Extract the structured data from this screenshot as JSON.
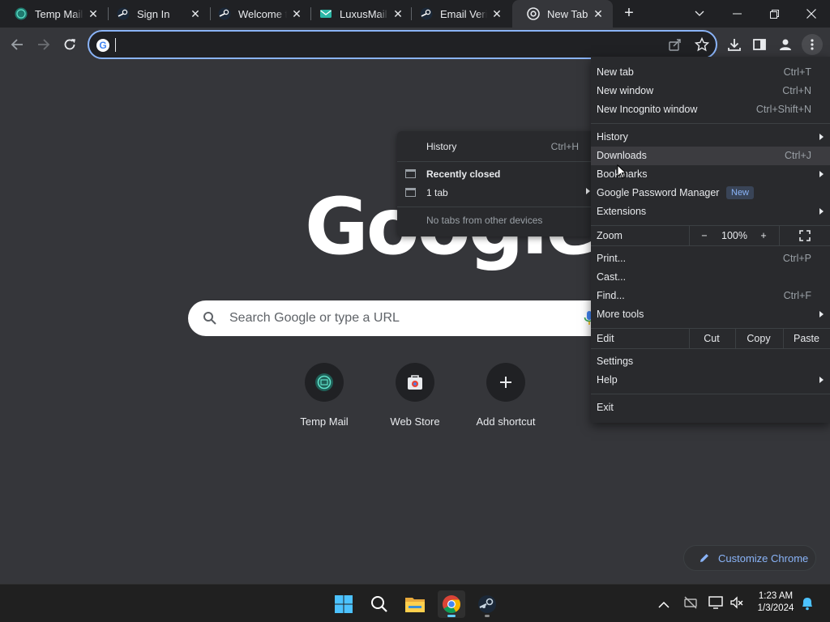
{
  "tabs": [
    {
      "title": "Temp Mail",
      "icon": "temp-mail-favicon"
    },
    {
      "title": "Sign In",
      "icon": "steam-favicon"
    },
    {
      "title": "Welcome to",
      "icon": "steam-favicon"
    },
    {
      "title": "LuxusMail - ",
      "icon": "luxusmail-favicon"
    },
    {
      "title": "Email Verification",
      "icon": "steam-favicon"
    },
    {
      "title": "New Tab",
      "icon": "chrome-favicon"
    }
  ],
  "omnibox": {
    "value": "",
    "placeholder": ""
  },
  "ntp": {
    "logo": "Google",
    "search_placeholder": "Search Google or type a URL",
    "shortcuts": [
      {
        "label": "Temp Mail"
      },
      {
        "label": "Web Store"
      },
      {
        "label": "Add shortcut"
      }
    ],
    "customize_label": "Customize Chrome"
  },
  "history_submenu": {
    "history_label": "History",
    "history_shortcut": "Ctrl+H",
    "recently_closed_label": "Recently closed",
    "one_tab_label": "1 tab",
    "no_tabs_label": "No tabs from other devices"
  },
  "menu": {
    "new_tab": "New tab",
    "new_tab_sc": "Ctrl+T",
    "new_window": "New window",
    "new_window_sc": "Ctrl+N",
    "new_incognito": "New Incognito window",
    "new_incognito_sc": "Ctrl+Shift+N",
    "history": "History",
    "downloads": "Downloads",
    "downloads_sc": "Ctrl+J",
    "bookmarks": "Bookmarks",
    "password_manager": "Google Password Manager",
    "new_badge": "New",
    "extensions": "Extensions",
    "zoom": "Zoom",
    "zoom_minus": "−",
    "zoom_level": "100%",
    "zoom_plus": "+",
    "print": "Print...",
    "print_sc": "Ctrl+P",
    "cast": "Cast...",
    "find": "Find...",
    "find_sc": "Ctrl+F",
    "more_tools": "More tools",
    "edit": "Edit",
    "cut": "Cut",
    "copy": "Copy",
    "paste": "Paste",
    "settings": "Settings",
    "help": "Help",
    "exit": "Exit"
  },
  "taskbar": {
    "apps": [
      "windows-start-icon",
      "search-icon",
      "file-explorer-icon",
      "chrome-icon",
      "steam-icon"
    ],
    "time": "1:23 AM",
    "date": "1/3/2024"
  },
  "colors": {
    "accent": "#8ab4f8",
    "menu_bg": "#292a2d",
    "page_bg": "#35363a",
    "tab_strip": "#202124"
  }
}
